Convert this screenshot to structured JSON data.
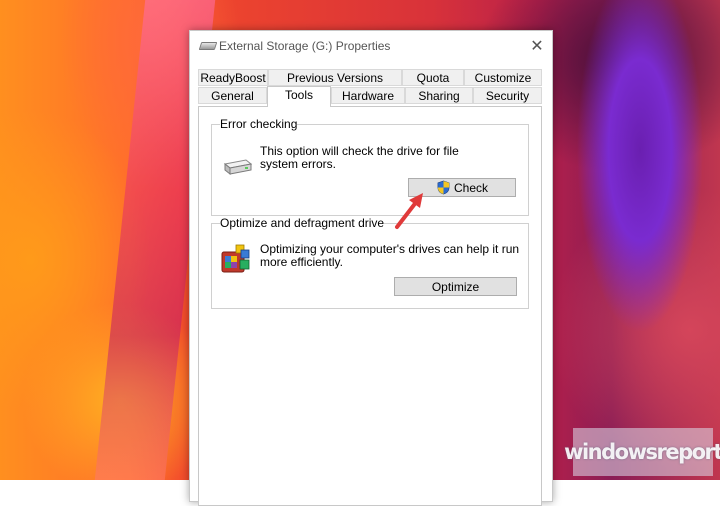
{
  "window": {
    "title": "External Storage (G:) Properties",
    "close_glyph": "✕"
  },
  "tabs": {
    "row_top": [
      "ReadyBoost",
      "Previous Versions",
      "Quota",
      "Customize"
    ],
    "row_bottom": [
      "General",
      "Tools",
      "Hardware",
      "Sharing",
      "Security"
    ],
    "active": "Tools"
  },
  "error_checking": {
    "title": "Error checking",
    "description_line1": "This option will check the drive for file",
    "description_line2": "system errors.",
    "button_label": "Check",
    "icon": "hard-drive-icon",
    "button_icon": "uac-shield-icon"
  },
  "optimize": {
    "title": "Optimize and defragment drive",
    "description_line1": "Optimizing your computer's drives can help it run",
    "description_line2": "more efficiently.",
    "button_label": "Optimize",
    "icon": "defragment-icon"
  },
  "watermark": "windowsreport",
  "colors": {
    "annotation_arrow": "#e03a3a",
    "button_face": "#e1e1e1",
    "shield_blue": "#2a6bd1",
    "shield_yellow": "#f3c623"
  }
}
